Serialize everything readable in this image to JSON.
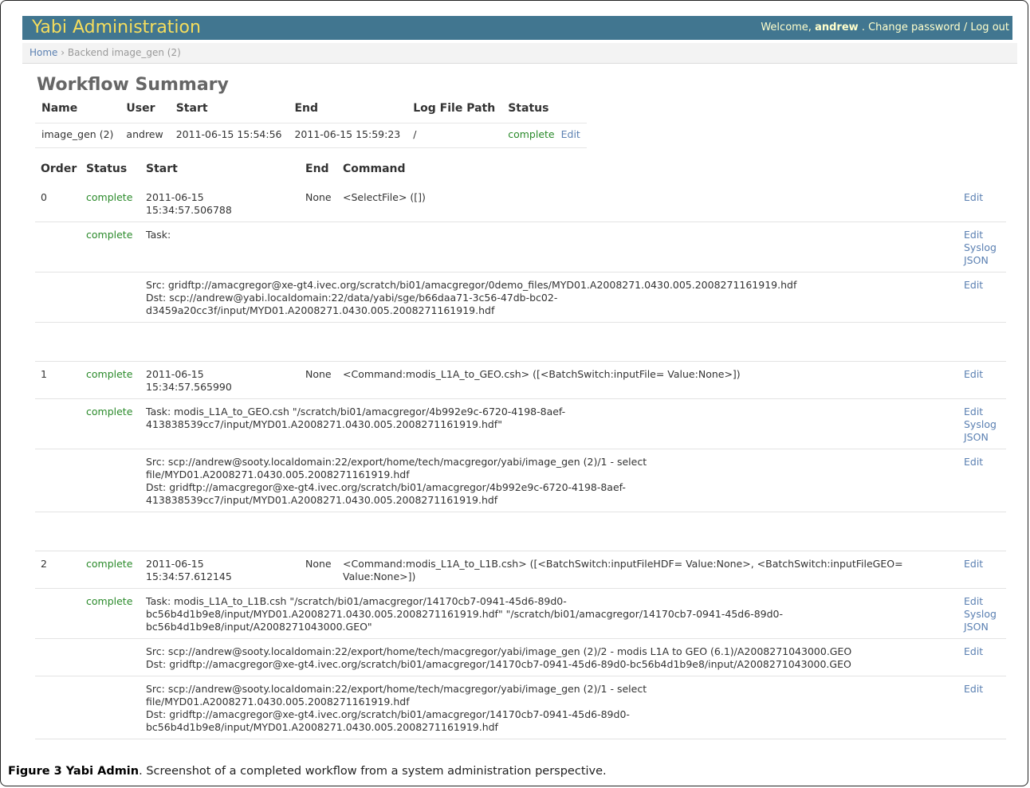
{
  "header": {
    "brand": "Yabi Administration",
    "welcome": "Welcome,",
    "username": "andrew",
    "tail": ". Change password / Log out"
  },
  "breadcrumbs": {
    "home": "Home",
    "sep": " › ",
    "current": "Backend image_gen (2)"
  },
  "page_title": "Workflow Summary",
  "summary": {
    "headers": [
      "Name",
      "User",
      "Start",
      "End",
      "Log File Path",
      "Status"
    ],
    "row": {
      "name": "image_gen (2)",
      "user": "andrew",
      "start": "2011-06-15 15:54:56",
      "end": "2011-06-15 15:59:23",
      "log_path": "/",
      "status": "complete",
      "edit": "Edit"
    }
  },
  "tasks": {
    "headers": [
      "Order",
      "Status",
      "Start",
      "End",
      "Command"
    ],
    "groups": [
      {
        "order": "0",
        "status": "complete",
        "start_date": "2011-06-15",
        "start_time": "15:34:57.506788",
        "end": "None",
        "command": "<SelectFile> ([])",
        "edit": "Edit",
        "task": {
          "status": "complete",
          "text": "Task:",
          "links": [
            "Edit",
            "Syslog",
            "JSON"
          ]
        },
        "transfers": [
          {
            "text": "Src: gridftp://amacgregor@xe-gt4.ivec.org/scratch/bi01/amacgregor/0demo_files/MYD01.A2008271.0430.005.2008271161919.hdf\nDst: scp://andrew@yabi.localdomain:22/data/yabi/sge/b66daa71-3c56-47db-bc02-\nd3459a20cc3f/input/MYD01.A2008271.0430.005.2008271161919.hdf",
            "edit": "Edit"
          }
        ]
      },
      {
        "order": "1",
        "status": "complete",
        "start_date": "2011-06-15",
        "start_time": "15:34:57.565990",
        "end": "None",
        "command": "<Command:modis_L1A_to_GEO.csh> ([<BatchSwitch:inputFile= Value:None>])",
        "edit": "Edit",
        "task": {
          "status": "complete",
          "text": "Task: modis_L1A_to_GEO.csh \"/scratch/bi01/amacgregor/4b992e9c-6720-4198-8aef-\n413838539cc7/input/MYD01.A2008271.0430.005.2008271161919.hdf\"",
          "links": [
            "Edit",
            "Syslog",
            "JSON"
          ]
        },
        "transfers": [
          {
            "text": "Src: scp://andrew@sooty.localdomain:22/export/home/tech/macgregor/yabi/image_gen (2)/1 - select\nfile/MYD01.A2008271.0430.005.2008271161919.hdf\nDst: gridftp://amacgregor@xe-gt4.ivec.org/scratch/bi01/amacgregor/4b992e9c-6720-4198-8aef-\n413838539cc7/input/MYD01.A2008271.0430.005.2008271161919.hdf",
            "edit": "Edit"
          }
        ]
      },
      {
        "order": "2",
        "status": "complete",
        "start_date": "2011-06-15",
        "start_time": "15:34:57.612145",
        "end": "None",
        "command": "<Command:modis_L1A_to_L1B.csh> ([<BatchSwitch:inputFileHDF= Value:None>, <BatchSwitch:inputFileGEO=\nValue:None>])",
        "edit": "Edit",
        "task": {
          "status": "complete",
          "text": "Task: modis_L1A_to_L1B.csh \"/scratch/bi01/amacgregor/14170cb7-0941-45d6-89d0-\nbc56b4d1b9e8/input/MYD01.A2008271.0430.005.2008271161919.hdf\" \"/scratch/bi01/amacgregor/14170cb7-0941-45d6-89d0-\nbc56b4d1b9e8/input/A2008271043000.GEO\"",
          "links": [
            "Edit",
            "Syslog",
            "JSON"
          ]
        },
        "transfers": [
          {
            "text": "Src: scp://andrew@sooty.localdomain:22/export/home/tech/macgregor/yabi/image_gen (2)/2 - modis L1A to GEO (6.1)/A2008271043000.GEO\nDst: gridftp://amacgregor@xe-gt4.ivec.org/scratch/bi01/amacgregor/14170cb7-0941-45d6-89d0-bc56b4d1b9e8/input/A2008271043000.GEO",
            "edit": "Edit"
          },
          {
            "text": "Src: scp://andrew@sooty.localdomain:22/export/home/tech/macgregor/yabi/image_gen (2)/1 - select\nfile/MYD01.A2008271.0430.005.2008271161919.hdf\nDst: gridftp://amacgregor@xe-gt4.ivec.org/scratch/bi01/amacgregor/14170cb7-0941-45d6-89d0-\nbc56b4d1b9e8/input/MYD01.A2008271.0430.005.2008271161919.hdf",
            "edit": "Edit"
          }
        ]
      }
    ]
  },
  "caption": {
    "bold": "Figure 3 Yabi Admin",
    "text": ". Screenshot of a completed workflow from a system administration perspective."
  }
}
